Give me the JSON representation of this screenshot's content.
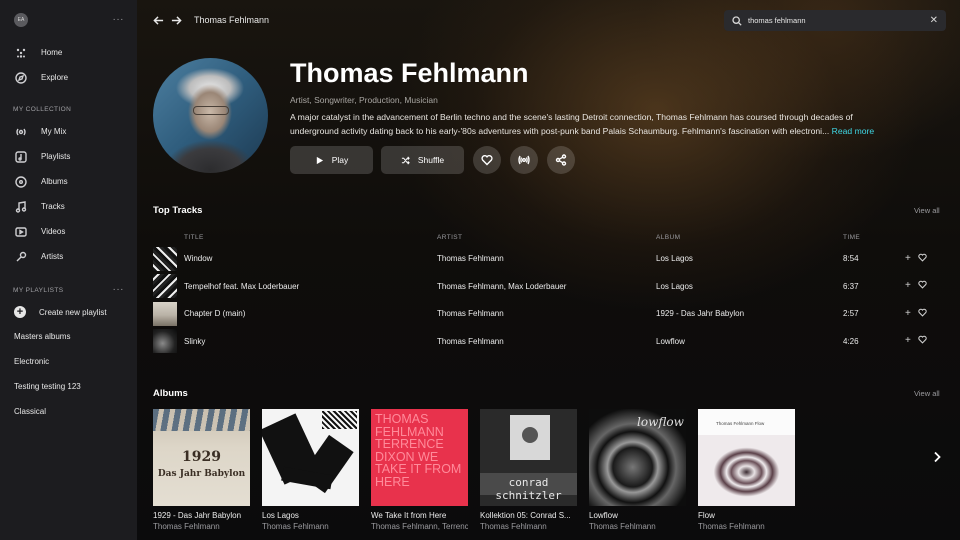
{
  "sidebar": {
    "avatar_initials": "EA",
    "menu_dots": "···",
    "nav": [
      {
        "label": "Home",
        "icon": "home-icon"
      },
      {
        "label": "Explore",
        "icon": "compass-icon"
      }
    ],
    "collection_label": "MY COLLECTION",
    "collection": [
      {
        "label": "My Mix",
        "icon": "mix-icon"
      },
      {
        "label": "Playlists",
        "icon": "playlist-icon"
      },
      {
        "label": "Albums",
        "icon": "album-icon"
      },
      {
        "label": "Tracks",
        "icon": "music-note-icon"
      },
      {
        "label": "Videos",
        "icon": "video-icon"
      },
      {
        "label": "Artists",
        "icon": "microphone-icon"
      }
    ],
    "playlists_label": "MY PLAYLISTS",
    "create_playlist": "Create new playlist",
    "playlists": [
      "Masters albums",
      "Electronic",
      "Testing testing 123",
      "Classical"
    ]
  },
  "topbar": {
    "breadcrumb": "Thomas Fehlmann",
    "search_value": "thomas fehlmann",
    "clear": "✕"
  },
  "artist": {
    "name": "Thomas Fehlmann",
    "roles": "Artist, Songwriter, Production, Musician",
    "bio_line1": "A major catalyst in the advancement of Berlin techno and the scene's lasting Detroit connection, Thomas Fehlmann has coursed through decades of",
    "bio_line2": "underground activity dating back to his early-'80s adventures with post-punk band Palais Schaumburg. Fehlmann's fascination with electroni...",
    "read_more": "Read more",
    "play_label": "Play",
    "shuffle_label": "Shuffle"
  },
  "top_tracks": {
    "title": "Top Tracks",
    "view_all": "View all",
    "columns": {
      "title": "TITLE",
      "artist": "ARTIST",
      "album": "ALBUM",
      "time": "TIME"
    },
    "rows": [
      {
        "title": "Window",
        "artist": "Thomas Fehlmann",
        "album": "Los Lagos",
        "time": "8:54"
      },
      {
        "title": "Tempelhof feat. Max Loderbauer",
        "artist": "Thomas Fehlmann, Max Loderbauer",
        "album": "Los Lagos",
        "time": "6:37"
      },
      {
        "title": "Chapter D (main)",
        "artist": "Thomas Fehlmann",
        "album": "1929 - Das Jahr Babylon",
        "time": "2:57"
      },
      {
        "title": "Slinky",
        "artist": "Thomas Fehlmann",
        "album": "Lowflow",
        "time": "4:26"
      }
    ],
    "add_glyph": "+"
  },
  "albums": {
    "title": "Albums",
    "view_all": "View all",
    "items": [
      {
        "title": "1929 - Das Jahr Babylon",
        "artist": "Thomas Fehlmann",
        "cover_year": "1929",
        "cover_text": "Das Jahr Babylon"
      },
      {
        "title": "Los Lagos",
        "artist": "Thomas Fehlmann"
      },
      {
        "title": "We Take It from Here",
        "artist": "Thomas Fehlmann, Terrence...",
        "cover_text": "THOMAS FEHLMANN TERRENCE DIXON WE TAKE IT FROM HERE"
      },
      {
        "title": "Kollektion 05: Conrad S...",
        "artist": "Thomas Fehlmann",
        "cover_text": "conrad schnitzler"
      },
      {
        "title": "Lowflow",
        "artist": "Thomas Fehlmann",
        "cover_text": "lowflow"
      },
      {
        "title": "Flow",
        "artist": "Thomas Fehlmann",
        "cover_text": "Thomas Fehlmann Flow"
      }
    ]
  },
  "colors": {
    "accent": "#3fd5e3",
    "sidebar_bg": "#1c1c1f",
    "album3_bg": "#e8324c"
  }
}
